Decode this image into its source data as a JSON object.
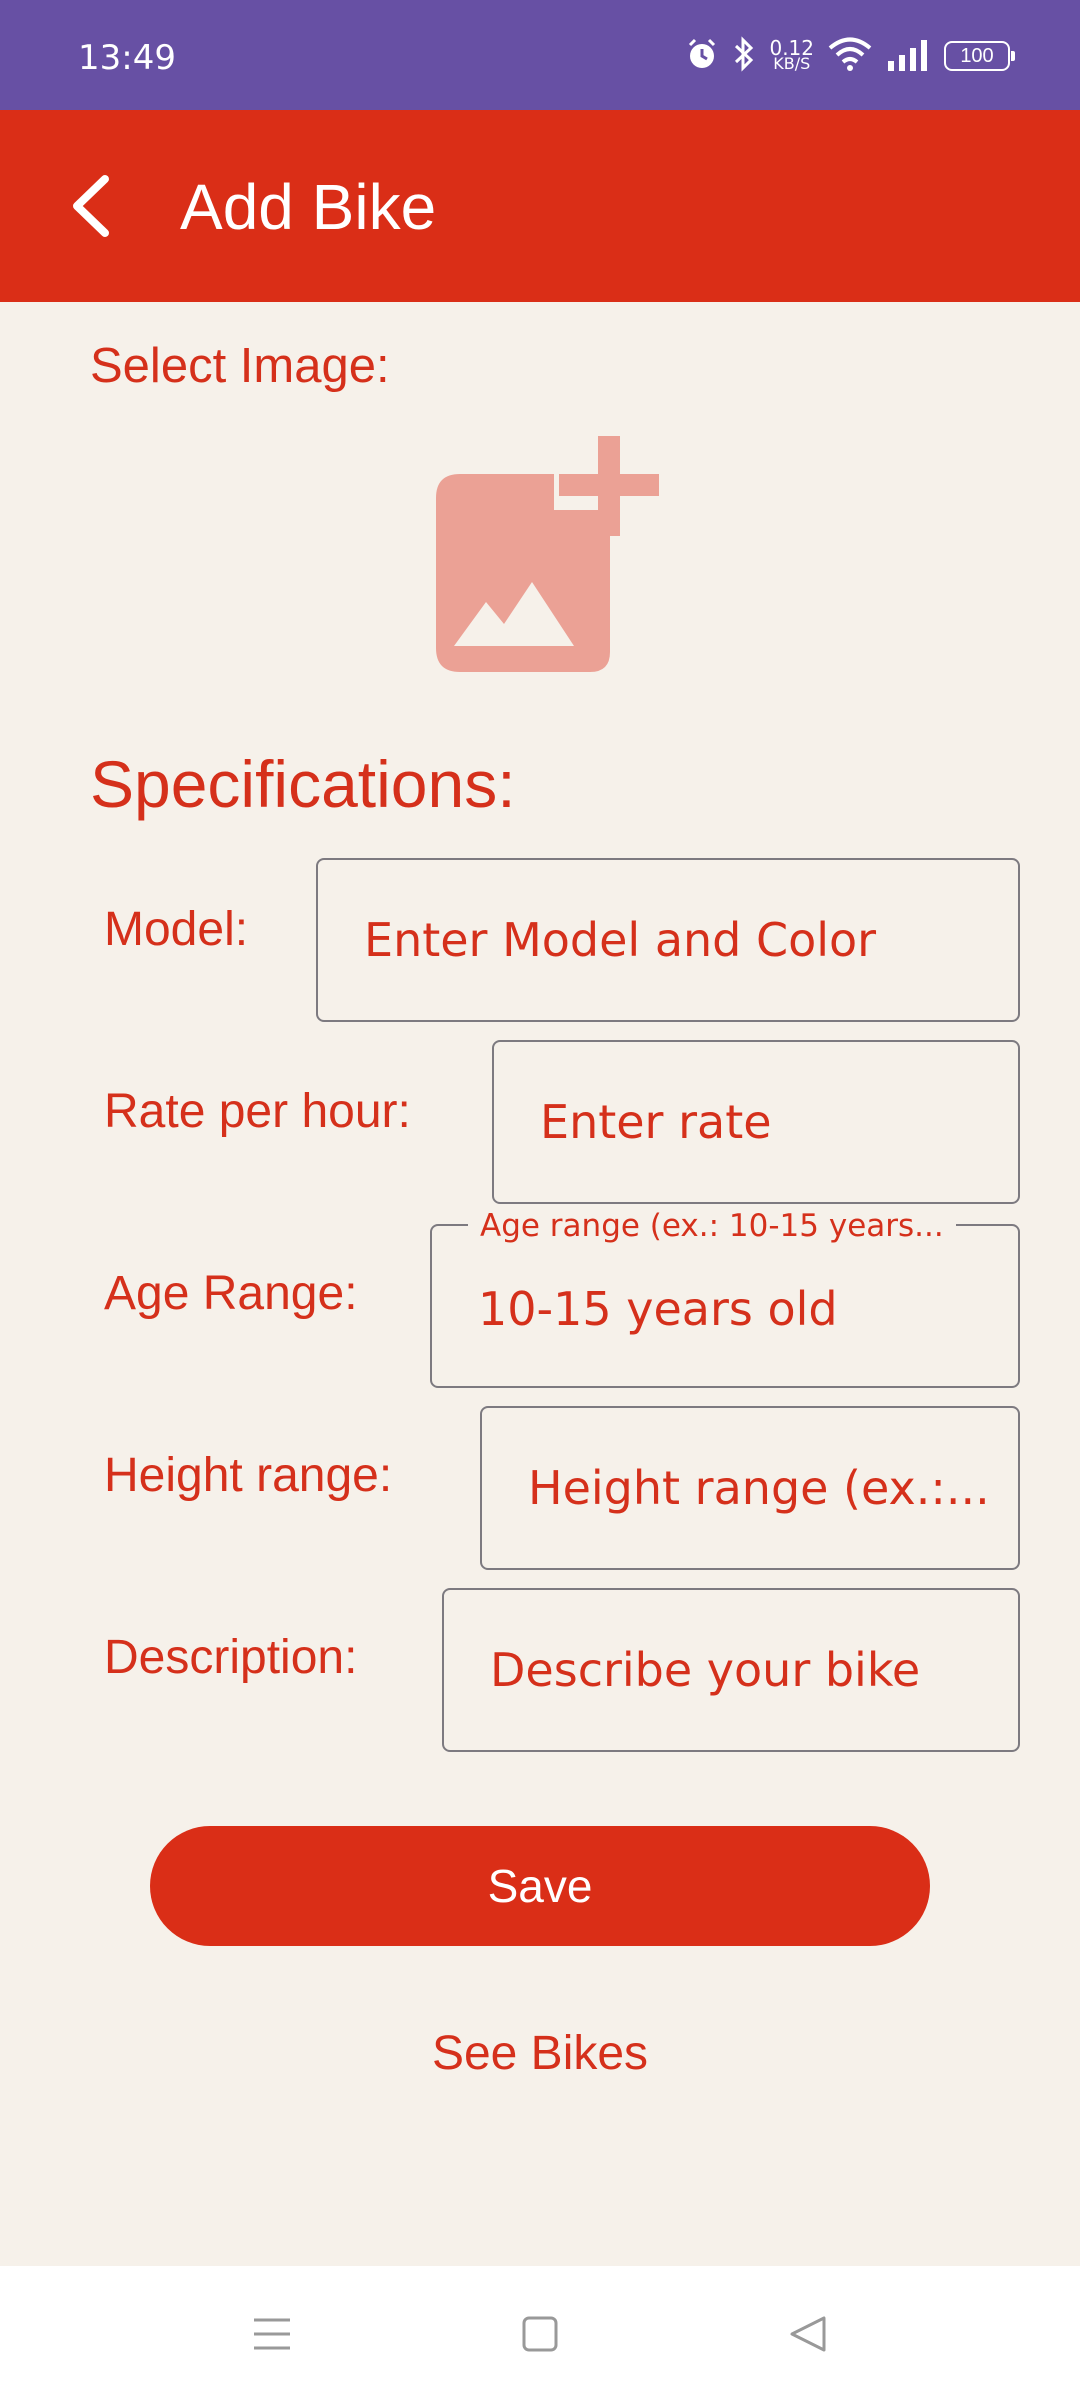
{
  "status_bar": {
    "time": "13:49",
    "net_speed_value": "0.12",
    "net_speed_unit": "KB/S",
    "battery": "100",
    "icons": [
      "alarm-icon",
      "bluetooth-icon",
      "wifi-icon",
      "signal-icon",
      "battery-icon"
    ]
  },
  "app_bar": {
    "title": "Add Bike",
    "back_icon": "back-arrow-icon"
  },
  "image_section": {
    "label": "Select Image:",
    "icon": "add-photo-icon"
  },
  "specifications": {
    "title": "Specifications:",
    "fields": {
      "model": {
        "label": "Model:",
        "placeholder": "Enter Model and Color",
        "value": ""
      },
      "rate": {
        "label": "Rate per hour:",
        "placeholder": "Enter rate",
        "value": ""
      },
      "age": {
        "label": "Age Range:",
        "floating_label": "Age range (ex.: 10-15 years...",
        "value": "10-15 years old"
      },
      "height": {
        "label": "Height range:",
        "placeholder": "Height range (ex.:...",
        "value": ""
      },
      "description": {
        "label": "Description:",
        "placeholder": "Describe your bike",
        "value": ""
      }
    }
  },
  "actions": {
    "save": "Save",
    "see_bikes": "See Bikes"
  },
  "nav_bar": {
    "icons": [
      "menu-icon",
      "home-icon",
      "back-icon"
    ]
  },
  "colors": {
    "status_bar": "#6750a4",
    "primary": "#da2e17",
    "background": "#f6f1ea",
    "image_icon": "#eba195"
  }
}
